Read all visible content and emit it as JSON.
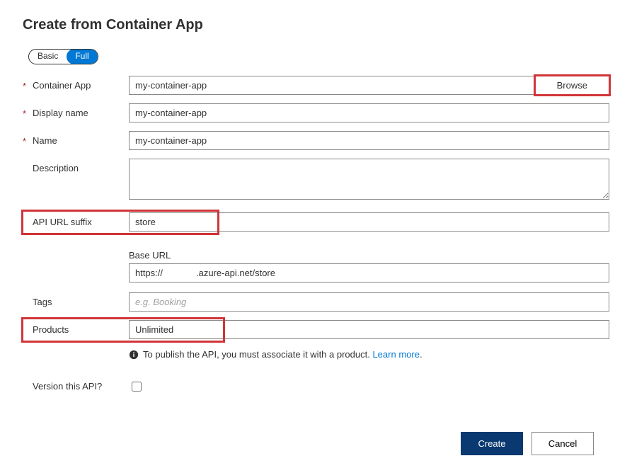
{
  "title": "Create from Container App",
  "toggle": {
    "basic": "Basic",
    "full": "Full",
    "active": "full"
  },
  "labels": {
    "containerApp": "Container App",
    "displayName": "Display name",
    "name": "Name",
    "description": "Description",
    "apiUrlSuffix": "API URL suffix",
    "baseUrl": "Base URL",
    "tags": "Tags",
    "products": "Products",
    "versionThis": "Version this API?"
  },
  "values": {
    "containerApp": "my-container-app",
    "displayName": "my-container-app",
    "name": "my-container-app",
    "description": "",
    "apiUrlSuffix": "store",
    "baseUrl": "https://             .azure-api.net/store",
    "tags": "",
    "products": "Unlimited",
    "versionChecked": false
  },
  "placeholders": {
    "tags": "e.g. Booking"
  },
  "buttons": {
    "browse": "Browse",
    "create": "Create",
    "cancel": "Cancel"
  },
  "info": {
    "text": "To publish the API, you must associate it with a product. ",
    "link": "Learn more"
  }
}
